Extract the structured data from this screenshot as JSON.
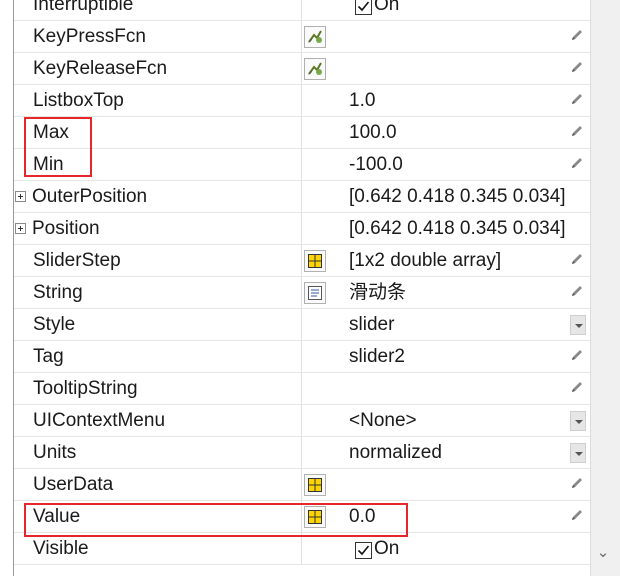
{
  "inspector": {
    "rows": [
      {
        "name": "Interruptible",
        "control": "checkbox",
        "checked": true,
        "check_label": "On"
      },
      {
        "name": "KeyPressFcn",
        "control": "button",
        "button_icon": "callback-editor-icon",
        "edit_icon": "pencil-icon"
      },
      {
        "name": "KeyReleaseFcn",
        "control": "button",
        "button_icon": "callback-editor-icon",
        "edit_icon": "pencil-icon"
      },
      {
        "name": "ListboxTop",
        "value": "1.0",
        "edit_icon": "pencil-icon"
      },
      {
        "name": "Max",
        "value": "100.0",
        "edit_icon": "pencil-icon"
      },
      {
        "name": "Min",
        "value": "-100.0",
        "edit_icon": "pencil-icon"
      },
      {
        "name": "OuterPosition",
        "value": "[0.642 0.418 0.345 0.034]",
        "expandable": true
      },
      {
        "name": "Position",
        "value": "[0.642 0.418 0.345 0.034]",
        "expandable": true
      },
      {
        "name": "SliderStep",
        "value": "[1x2  double array]",
        "button_icon": "array-editor-icon",
        "edit_icon": "pencil-icon"
      },
      {
        "name": "String",
        "value": "滑动条",
        "button_icon": "text-editor-icon",
        "edit_icon": "pencil-icon"
      },
      {
        "name": "Style",
        "value": "slider",
        "control": "dropdown"
      },
      {
        "name": "Tag",
        "value": "slider2",
        "edit_icon": "pencil-icon"
      },
      {
        "name": "TooltipString",
        "value": "",
        "edit_icon": "pencil-icon"
      },
      {
        "name": "UIContextMenu",
        "value": "<None>",
        "control": "dropdown"
      },
      {
        "name": "Units",
        "value": "normalized",
        "control": "dropdown"
      },
      {
        "name": "UserData",
        "value": "",
        "button_icon": "array-editor-icon",
        "edit_icon": "pencil-icon"
      },
      {
        "name": "Value",
        "value": "0.0",
        "button_icon": "array-editor-icon",
        "edit_icon": "pencil-icon"
      },
      {
        "name": "Visible",
        "control": "checkbox",
        "checked": true,
        "check_label": "On"
      }
    ],
    "highlight_color": "#e8252b",
    "scrollbar_icon": "chevron-down-icon"
  }
}
